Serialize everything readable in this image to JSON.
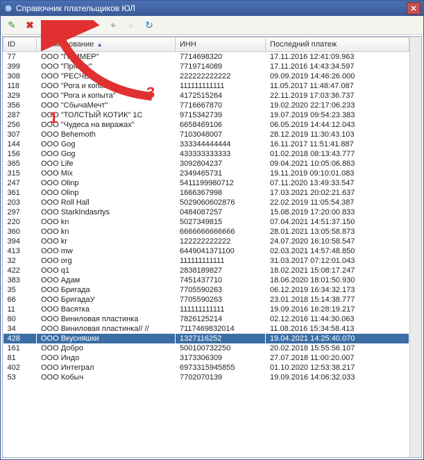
{
  "window": {
    "title": "Справочник плательщиков ЮЛ"
  },
  "annotations": {
    "num1": "1",
    "num3": "3"
  },
  "toolbar": {
    "edit": "✎",
    "delete": "✖",
    "import": "⬇",
    "export": "⬆",
    "link": "⚭",
    "filter": "⌖",
    "filter_clear": "⌕",
    "refresh": "↻"
  },
  "columns": {
    "id": "ID",
    "name": "Наименование",
    "inn": "ИНН",
    "last": "Последний платеж"
  },
  "sort_indicator": "▲",
  "selected_id": "428",
  "rows": [
    {
      "id": "77",
      "name": "ООО \"ПРИМЕР\"",
      "inn": "7714698320",
      "last": "17.11.2016 12:41:09.963"
    },
    {
      "id": "399",
      "name": "ООО \"Пряник\"",
      "inn": "7719714089",
      "last": "17.11.2016 14:43:34.597"
    },
    {
      "id": "308",
      "name": "ООО \"РЕСЧЕТ\"",
      "inn": "222222222222",
      "last": "09.09.2019 14:46:26.000"
    },
    {
      "id": "118",
      "name": "ООО \"Рога и копыта\"",
      "inn": "111111111111",
      "last": "11.05.2017 11:48:47.087"
    },
    {
      "id": "329",
      "name": "ООО \"Рога и копыта\"",
      "inn": "4172515264",
      "last": "22.11.2019 17:03:36.737"
    },
    {
      "id": "356",
      "name": "ООО \"СбычаМечт\"",
      "inn": "7716667870",
      "last": "19.02.2020 22:17:06.233"
    },
    {
      "id": "287",
      "name": "ООО \"ТОЛСТЫЙ КОТИК\" 1С",
      "inn": "9715342739",
      "last": "19.07.2019 09:54:23.383"
    },
    {
      "id": "256",
      "name": "ООО \"Чудеса на виражах\"",
      "inn": "6658469106",
      "last": "06.05.2019 14:44:12.043"
    },
    {
      "id": "307",
      "name": "ООО Behemoth",
      "inn": "7103048007",
      "last": "28.12.2019 11:30:43.103"
    },
    {
      "id": "144",
      "name": "ООО Gog",
      "inn": "333344444444",
      "last": "16.11.2017 11:51:41.887"
    },
    {
      "id": "156",
      "name": "ООО Gog",
      "inn": "433333333333",
      "last": "01.02.2018 08:13:43.777"
    },
    {
      "id": "365",
      "name": "ООО Life",
      "inn": "3092804237",
      "last": "09.04.2021 10:05:06.863"
    },
    {
      "id": "315",
      "name": "ООО Mix",
      "inn": "2349465731",
      "last": "19.11.2019 09:10:01.083"
    },
    {
      "id": "247",
      "name": "ООО Olinp",
      "inn": "5411199980712",
      "last": "07.11.2020 13:49:33.547"
    },
    {
      "id": "361",
      "name": "ООО Olinp",
      "inn": "1666367998",
      "last": "17.03.2021 20:02:21.637"
    },
    {
      "id": "203",
      "name": "ООО Roll Hall",
      "inn": "5029060602876",
      "last": "22.02.2019 11:05:54.387"
    },
    {
      "id": "297",
      "name": "ООО StarkIndasrtys",
      "inn": "0484087257",
      "last": "15.08.2019 17:20:00.833"
    },
    {
      "id": "220",
      "name": "ООО kn",
      "inn": "5027349815",
      "last": "07.04.2021 14:51:37.150"
    },
    {
      "id": "360",
      "name": "ООО kn",
      "inn": "6666666666666",
      "last": "28.01.2021 13:05:58.873"
    },
    {
      "id": "394",
      "name": "ООО kr",
      "inn": "122222222222",
      "last": "24.07.2020 16:10:58.547"
    },
    {
      "id": "413",
      "name": "ООО mw",
      "inn": "6449041371100",
      "last": "02.03.2021 14:57:48.850"
    },
    {
      "id": "32",
      "name": "ООО org",
      "inn": "111111111111",
      "last": "31.03.2017 07:12:01.043"
    },
    {
      "id": "422",
      "name": "ООО q1",
      "inn": "2838189827",
      "last": "18.02.2021 15:08:17.247"
    },
    {
      "id": "383",
      "name": "ООО Адам",
      "inn": "7451437710",
      "last": "18.06.2020 18:01:50.930"
    },
    {
      "id": "35",
      "name": "ООО Бригада",
      "inn": "7705590263",
      "last": "06.12.2019 16:34:32.173"
    },
    {
      "id": "66",
      "name": "ООО БригадаУ",
      "inn": "7705590263",
      "last": "23.01.2018 15:14:38.777"
    },
    {
      "id": "11",
      "name": "ООО Васятка",
      "inn": "111111111111",
      "last": "19.09.2016 16:28:19.217"
    },
    {
      "id": "80",
      "name": "ООО Виниловая пластинка",
      "inn": "7826125214",
      "last": "02.12.2016 11:44:30.063"
    },
    {
      "id": "34",
      "name": "ООО Виниловая пластинка// //",
      "inn": "7117469832014",
      "last": "11.08.2016 15:34:58.413"
    },
    {
      "id": "428",
      "name": "ООО Вкусняшки",
      "inn": "1327116252",
      "last": "19.04.2021 14:25:40.070"
    },
    {
      "id": "161",
      "name": "ООО Добро",
      "inn": "500100732250",
      "last": "20.02.2018 15:55:56.107"
    },
    {
      "id": "81",
      "name": "ООО Индо",
      "inn": "3173306309",
      "last": "27.07.2018 11:00:20.007"
    },
    {
      "id": "402",
      "name": "ООО Интеграл",
      "inn": "6973315945855",
      "last": "01.10.2020 12:53:38.217"
    },
    {
      "id": "53",
      "name": "ООО Кобыч",
      "inn": "7702070139",
      "last": "19.09.2016 14:06:32.033"
    }
  ]
}
